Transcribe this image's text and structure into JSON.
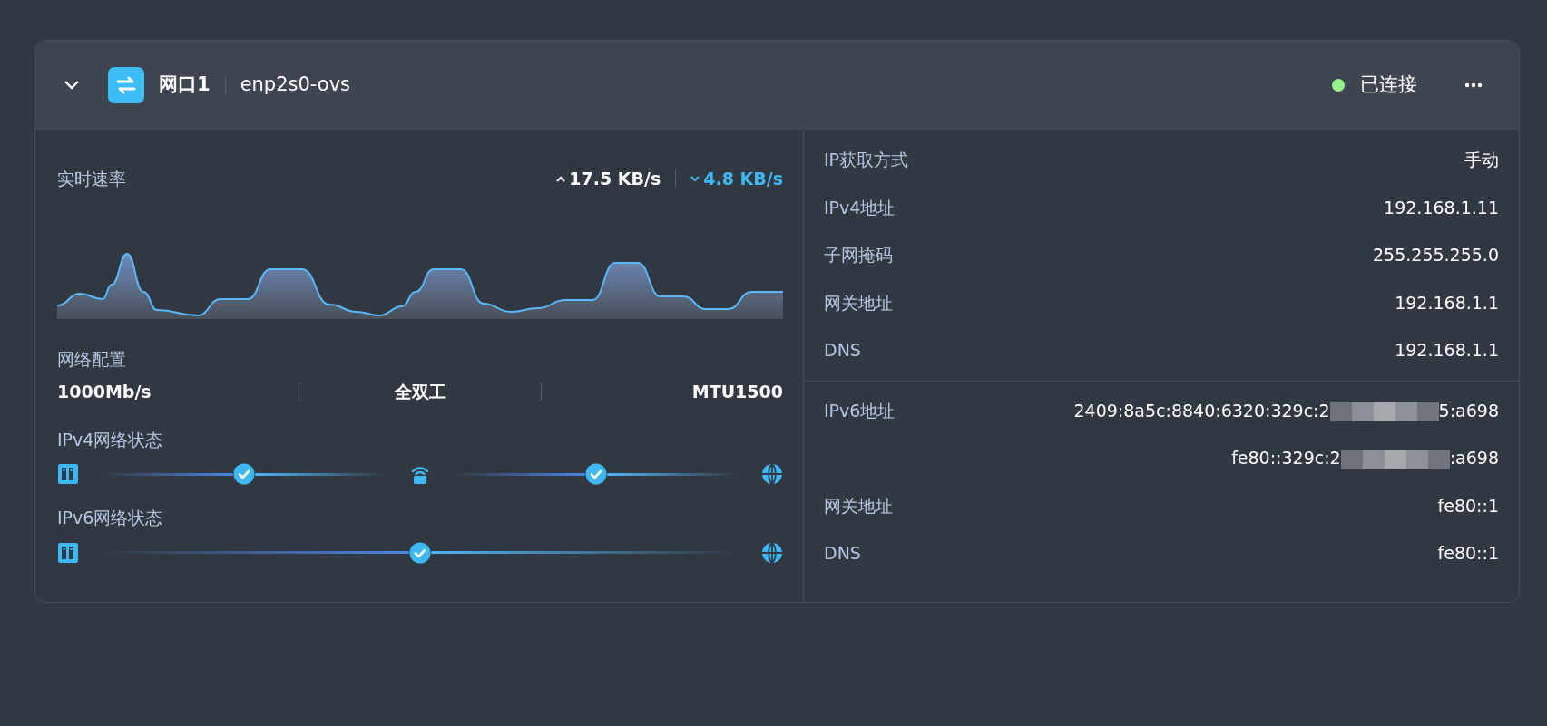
{
  "interface": {
    "name": "网口1",
    "device": "enp2s0-ovs",
    "expanded": true,
    "status": {
      "label": "已连接",
      "color": "#98f58e"
    }
  },
  "speed": {
    "title": "实时速率",
    "upload": "17.5 KB/s",
    "download": "4.8 KB/s"
  },
  "config": {
    "title": "网络配置",
    "values": [
      "1000Mb/s",
      "全双工",
      "MTU1500"
    ]
  },
  "paths": [
    {
      "title": "IPv4网络状态",
      "nodes": [
        {
          "kind": "server"
        },
        {
          "kind": "check"
        },
        {
          "kind": "router"
        },
        {
          "kind": "check"
        },
        {
          "kind": "globe"
        }
      ]
    },
    {
      "title": "IPv6网络状态",
      "nodes": [
        {
          "kind": "server"
        },
        {
          "kind": "check"
        },
        {
          "kind": "globe"
        }
      ]
    }
  ],
  "ipv4": [
    {
      "label": "IP获取方式",
      "value": "手动"
    },
    {
      "label": "IPv4地址",
      "value": "192.168.1.11"
    },
    {
      "label": "子网掩码",
      "value": "255.255.255.0"
    },
    {
      "label": "网关地址",
      "value": "192.168.1.1"
    },
    {
      "label": "DNS",
      "value": "192.168.1.1"
    }
  ],
  "ipv6": [
    {
      "label": "IPv6地址",
      "value": "2409:8a5c:8840:6320:329c:2",
      "value_end": "5:a698",
      "redacted": true
    },
    {
      "value": "fe80::329c:2",
      "value_end": ":a698",
      "redacted": true
    },
    {
      "label": "网关地址",
      "value": "fe80::1"
    },
    {
      "label": "DNS",
      "value": "fe80::1"
    }
  ]
}
